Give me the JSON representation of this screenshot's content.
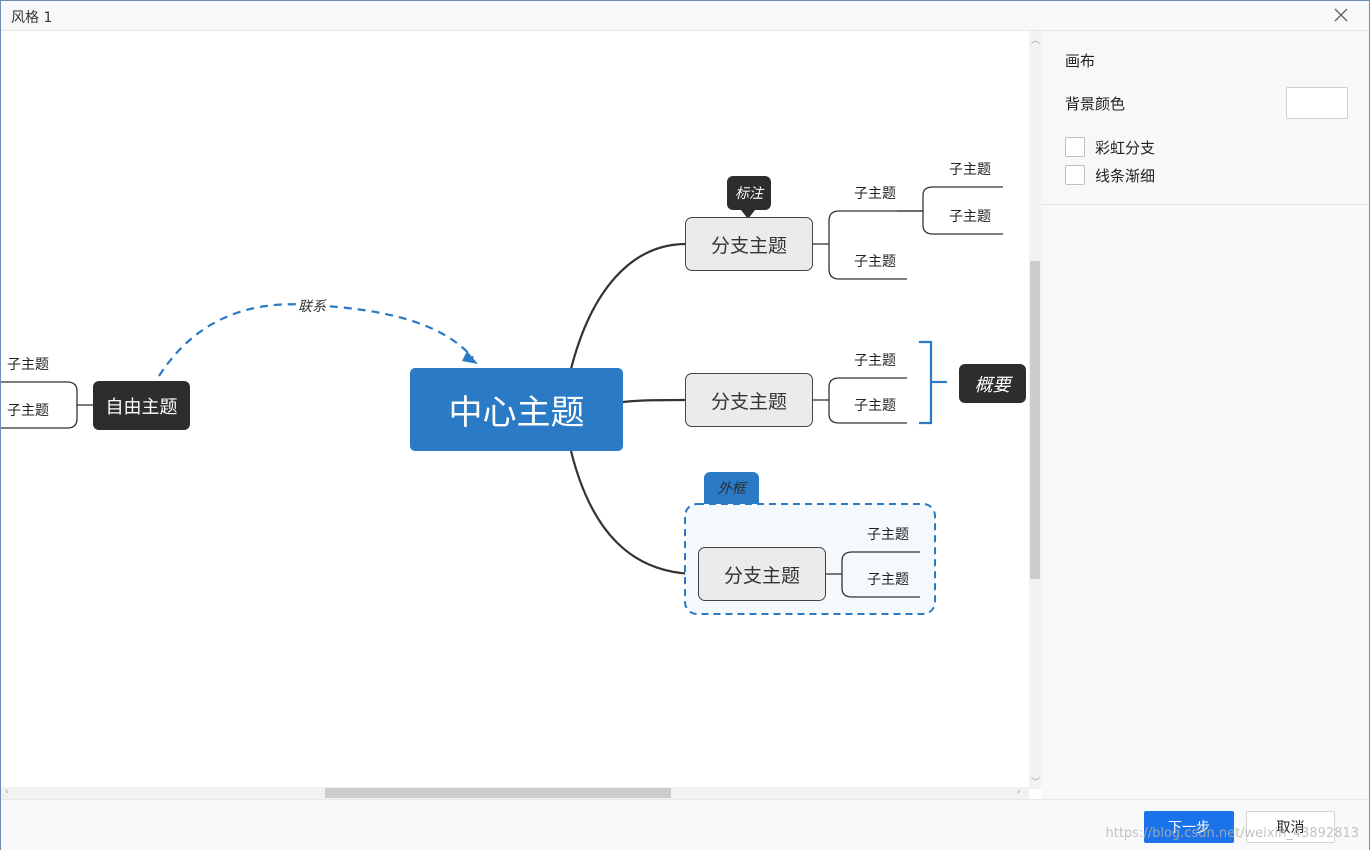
{
  "window": {
    "title": "风格 1"
  },
  "mindmap": {
    "central": "中心主题",
    "branches": [
      "分支主题",
      "分支主题",
      "分支主题"
    ],
    "subtopic": "子主题",
    "free_topic": "自由主题",
    "relationship": "联系",
    "callout": "标注",
    "summary": "概要",
    "boundary": "外框"
  },
  "panel": {
    "section_title": "画布",
    "background_color_label": "背景颜色",
    "background_color": "#ffffff",
    "rainbow_branch_label": "彩虹分支",
    "tapered_lines_label": "线条渐细"
  },
  "footer": {
    "next_label": "下一步",
    "cancel_label": "取消"
  },
  "watermark": "https://blog.csdn.net/weixin_43892813",
  "colors": {
    "accent": "#2a7ac6",
    "dark_node": "#2d2d2d",
    "button": "#1a73e8"
  },
  "icons": [
    "close-icon",
    "scroll-up-icon",
    "scroll-down-icon",
    "scroll-left-icon",
    "scroll-right-icon"
  ]
}
